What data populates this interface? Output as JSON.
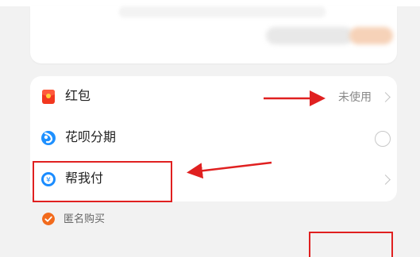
{
  "options": {
    "hongbao": {
      "label": "红包",
      "value": "未使用"
    },
    "huabei": {
      "label": "花呗分期"
    },
    "bangwofu": {
      "label": "帮我付",
      "icon_glyph": "¥"
    }
  },
  "anonymous": {
    "label": "匿名购买"
  },
  "colors": {
    "annotation": "#e02020",
    "accent": "#f26b1d",
    "huabei": "#1e90ff",
    "bangwofu": "#1a8cff"
  },
  "icons": {
    "hongbao": "red-envelope-icon",
    "huabei": "huabei-icon",
    "bangwofu": "yen-circle-icon",
    "chevron": "chevron-right-icon",
    "anonymous": "check-circle-icon"
  }
}
